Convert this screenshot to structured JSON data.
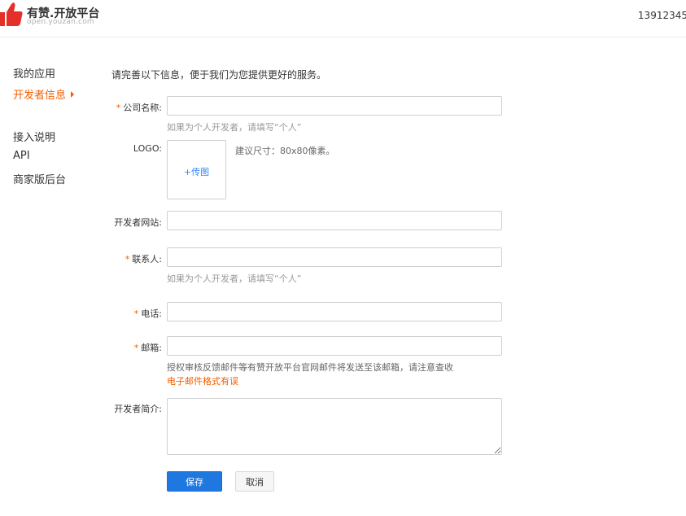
{
  "header": {
    "brand_title": "有赞.开放平台",
    "brand_subtitle": "open.youzan.com",
    "username": "13912345",
    "logo_icon": "thumbs-up-icon",
    "logo_color": "#e5302a"
  },
  "sidebar": {
    "items": [
      {
        "label": "我的应用"
      },
      {
        "label": "开发者信息"
      },
      {
        "label": "接入说明"
      },
      {
        "label": "API"
      },
      {
        "label": "商家版后台"
      }
    ],
    "active_color": "#f35d00"
  },
  "form": {
    "intro": "请完善以下信息，便于我们为您提供更好的服务。",
    "required_mark": "*",
    "company": {
      "label": "公司名称:",
      "value": "",
      "hint": "如果为个人开发者，请填写“个人”"
    },
    "logo": {
      "label": "LOGO:",
      "upload_label": "+传图",
      "hint": "建议尺寸：80x80像素。"
    },
    "website": {
      "label": "开发者网站:",
      "value": ""
    },
    "contact": {
      "label": "联系人:",
      "value": "",
      "hint": "如果为个人开发者，请填写“个人”"
    },
    "phone": {
      "label": "电话:",
      "value": ""
    },
    "email": {
      "label": "邮箱:",
      "value": "",
      "hint": "授权审核反馈邮件等有赞开放平台官网邮件将发送至该邮箱，请注意查收",
      "error": "电子邮件格式有误"
    },
    "intro_field": {
      "label": "开发者简介:",
      "value": ""
    },
    "save_label": "保存",
    "cancel_label": "取消",
    "primary_color": "#1f78e0"
  }
}
